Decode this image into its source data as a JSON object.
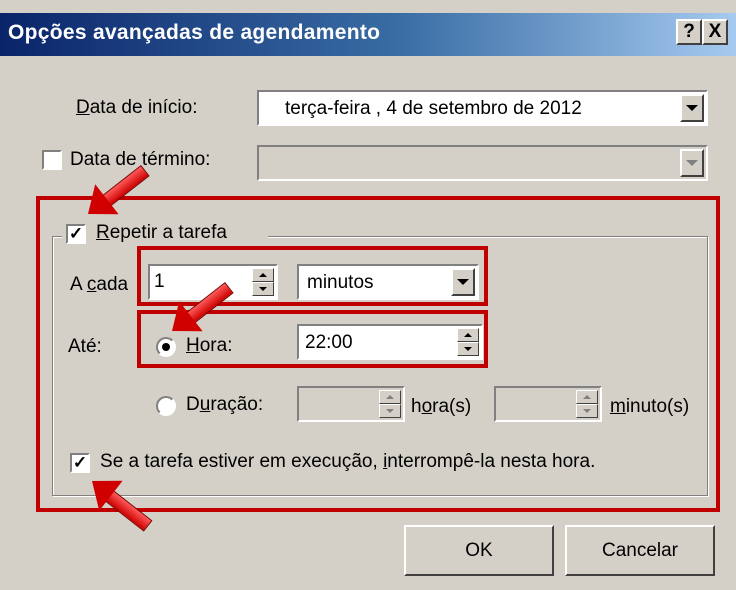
{
  "window": {
    "title": "Opções avançadas de agendamento",
    "help_button": "?",
    "close_button": "X"
  },
  "start_date": {
    "label": "Data de início:",
    "mnemonic": "D",
    "rest": "ata de início:",
    "value": "terça-feira  ,  4 de setembro de 2012"
  },
  "end_date": {
    "label": "Data de término:",
    "checked": false
  },
  "repeat": {
    "label": "Repetir a tarefa",
    "mnemonic": "R",
    "rest": "epetir a tarefa",
    "checked": true,
    "every_label_pre": "A ",
    "every_label_mn": "c",
    "every_label_post": "ada",
    "every_value": "1",
    "unit_value": "minutos",
    "until_label": "Até:",
    "time_option": {
      "mnemonic": "H",
      "rest": "ora:",
      "selected": true,
      "value": "22:00"
    },
    "duration_option": {
      "pre": "D",
      "mnemonic": "u",
      "rest": "ração:",
      "selected": false,
      "hours_pre": "h",
      "hours_mn": "o",
      "hours_post": "ra(s)",
      "minutes_mn": "m",
      "minutes_post": "inuto(s)"
    },
    "stop_task": {
      "checked": true,
      "pre": "S",
      "mn": "",
      "text1": "e a tarefa estiver em execução, ",
      "mn2": "i",
      "text2": "nterrompê-la nesta hora."
    }
  },
  "buttons": {
    "ok": "OK",
    "cancel": "Cancelar"
  },
  "colors": {
    "titlebar_start": "#0a246a",
    "titlebar_end": "#a6caf0",
    "highlight": "#c00000",
    "face": "#d4d0c8"
  }
}
